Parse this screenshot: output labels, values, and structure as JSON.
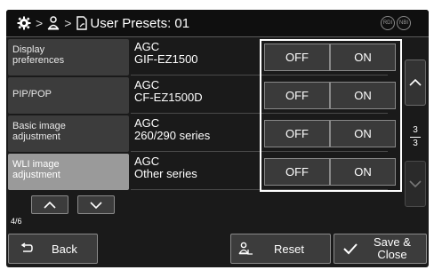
{
  "header": {
    "title": "User Presets: 01",
    "icons": [
      "settings-gear-icon",
      "user-icon",
      "document-icon",
      "rdi-indicator",
      "nbi-indicator"
    ],
    "rdi_label": "RDI",
    "nbi_label": "NBI"
  },
  "menu": {
    "items": [
      {
        "line1": "Display",
        "line2": "preferences"
      },
      {
        "line1": "PIP/POP",
        "line2": ""
      },
      {
        "line1": "Basic image",
        "line2": "adjustment"
      },
      {
        "line1": "WLI image",
        "line2": "adjustment"
      }
    ],
    "active_index": 3,
    "page_indicator": "4/6"
  },
  "rows": [
    {
      "line1": "AGC",
      "line2": "GIF-EZ1500",
      "off": "OFF",
      "on": "ON"
    },
    {
      "line1": "AGC",
      "line2": "CF-EZ1500D",
      "off": "OFF",
      "on": "ON"
    },
    {
      "line1": "AGC",
      "line2": "260/290 series",
      "off": "OFF",
      "on": "ON"
    },
    {
      "line1": "AGC",
      "line2": "Other series",
      "off": "OFF",
      "on": "ON"
    }
  ],
  "scroll": {
    "current": "3",
    "total": "3"
  },
  "footer": {
    "back_label": "Back",
    "reset_label": "Reset",
    "save_line1": "Save &",
    "save_line2": "Close"
  },
  "colors": {
    "background": "#1a1a1a",
    "button": "#3c3c3c",
    "active_menu": "#9a9a9a",
    "highlight": "#ffffff"
  }
}
